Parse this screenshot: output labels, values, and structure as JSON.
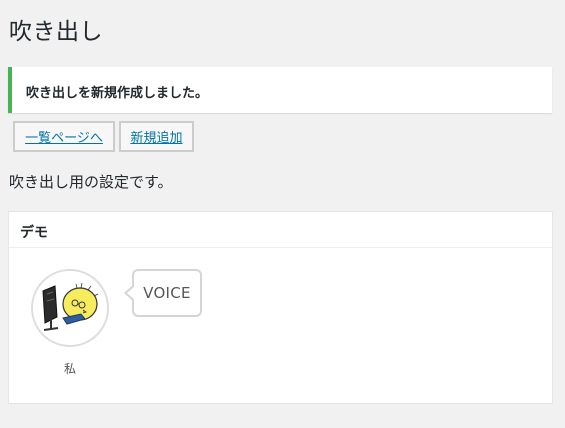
{
  "page": {
    "title": "吹き出し",
    "description": "吹き出し用の設定です。"
  },
  "notice": {
    "message": "吹き出しを新規作成しました。",
    "color": "#46b450"
  },
  "actions": {
    "list_label": "一覧ページへ",
    "add_label": "新規追加"
  },
  "demo": {
    "title": "デモ",
    "avatar_name": "私",
    "bubble_text": "VOICE"
  },
  "icons": {
    "avatar": "chick-at-computer-icon"
  },
  "colors": {
    "link": "#0073aa",
    "background": "#f1f1f1"
  }
}
